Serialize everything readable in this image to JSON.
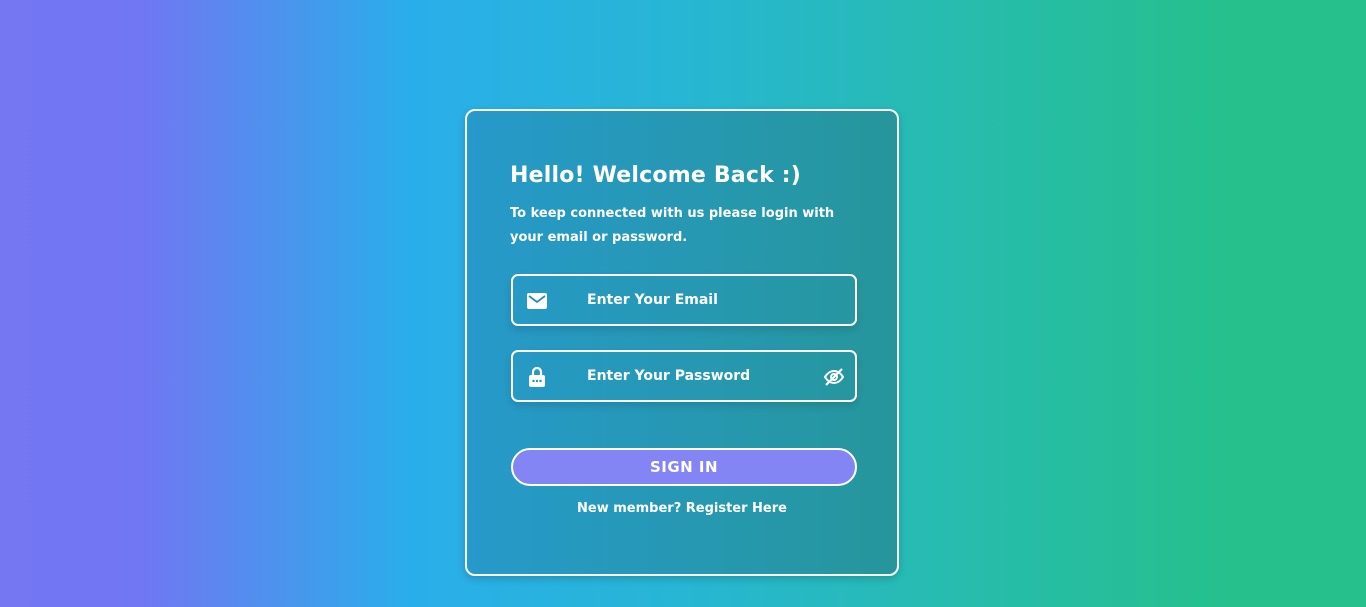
{
  "login": {
    "title": "Hello! Welcome Back :)",
    "subtitle": "To keep connected with us please login with your email or password.",
    "email": {
      "placeholder": "Enter Your Email",
      "value": "",
      "icon": "envelope-icon"
    },
    "password": {
      "placeholder": "Enter Your Password",
      "value": "",
      "icon": "lock-icon",
      "toggle_icon": "eye-slash-icon"
    },
    "submit_label": "SIGN IN",
    "register_link": "New member? Register Here"
  },
  "colors": {
    "gradient_left": "#7176f2",
    "gradient_mid": "#2aaeea",
    "gradient_right": "#25c08c",
    "button": "#8385f4",
    "text": "#ffffff"
  }
}
